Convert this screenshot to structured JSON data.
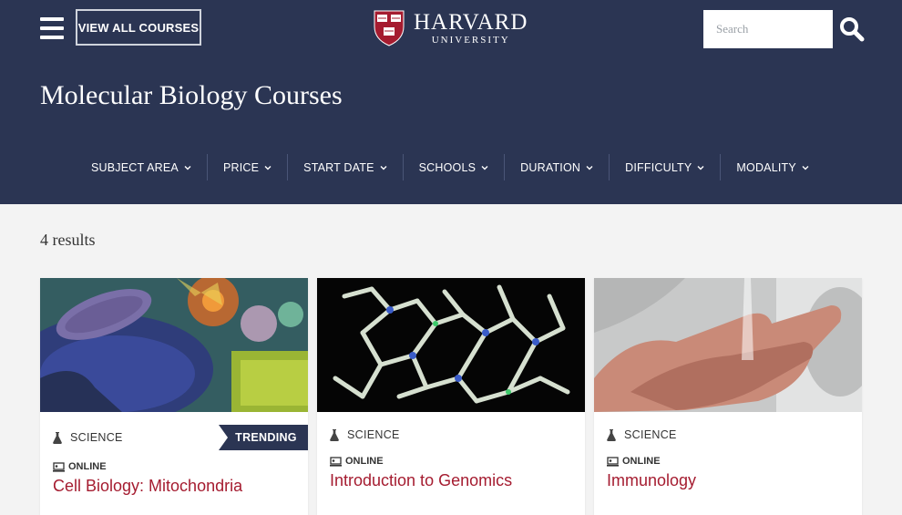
{
  "header": {
    "view_all_label": "VIEW ALL COURSES",
    "logo_main": "HARVARD",
    "logo_sub": "UNIVERSITY",
    "search_placeholder": "Search",
    "page_title": "Molecular Biology Courses"
  },
  "filters": [
    "SUBJECT AREA",
    "PRICE",
    "START DATE",
    "SCHOOLS",
    "DURATION",
    "DIFFICULTY",
    "MODALITY"
  ],
  "results_text": "4 results",
  "cards": [
    {
      "category": "SCIENCE",
      "badge": "TRENDING",
      "modality": "ONLINE",
      "title": "Cell Biology: Mitochondria"
    },
    {
      "category": "SCIENCE",
      "modality": "ONLINE",
      "title": "Introduction to Genomics"
    },
    {
      "category": "SCIENCE",
      "modality": "ONLINE",
      "title": "Immunology"
    }
  ],
  "colors": {
    "navy": "#2b3553",
    "crimson": "#a51c30"
  },
  "icons": [
    "menu-icon",
    "search-icon",
    "flask-icon",
    "online-course-icon",
    "chevron-down-icon"
  ]
}
